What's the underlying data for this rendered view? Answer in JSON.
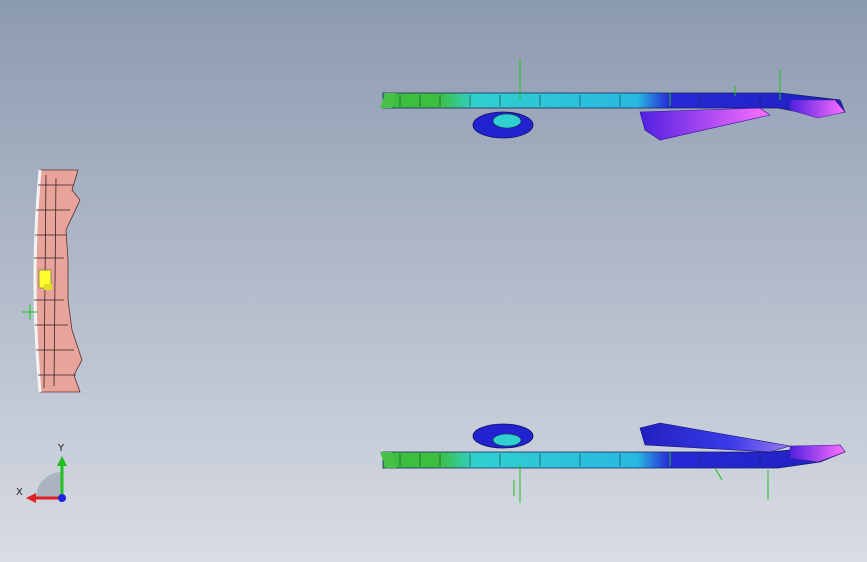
{
  "viewport": {
    "background_top": "#8c9ab0",
    "background_bottom": "#d6dae3"
  },
  "parts": {
    "left_part_color": "#e8a49b",
    "bar_colors": [
      "#3dbf3d",
      "#2fd6d6",
      "#2a2adf",
      "#cc44e0",
      "#e6e62a"
    ]
  },
  "triad": {
    "x_label": "X",
    "y_label": "Y",
    "x_color": "#e02020",
    "y_color": "#20c020",
    "z_color": "#2020e0"
  }
}
